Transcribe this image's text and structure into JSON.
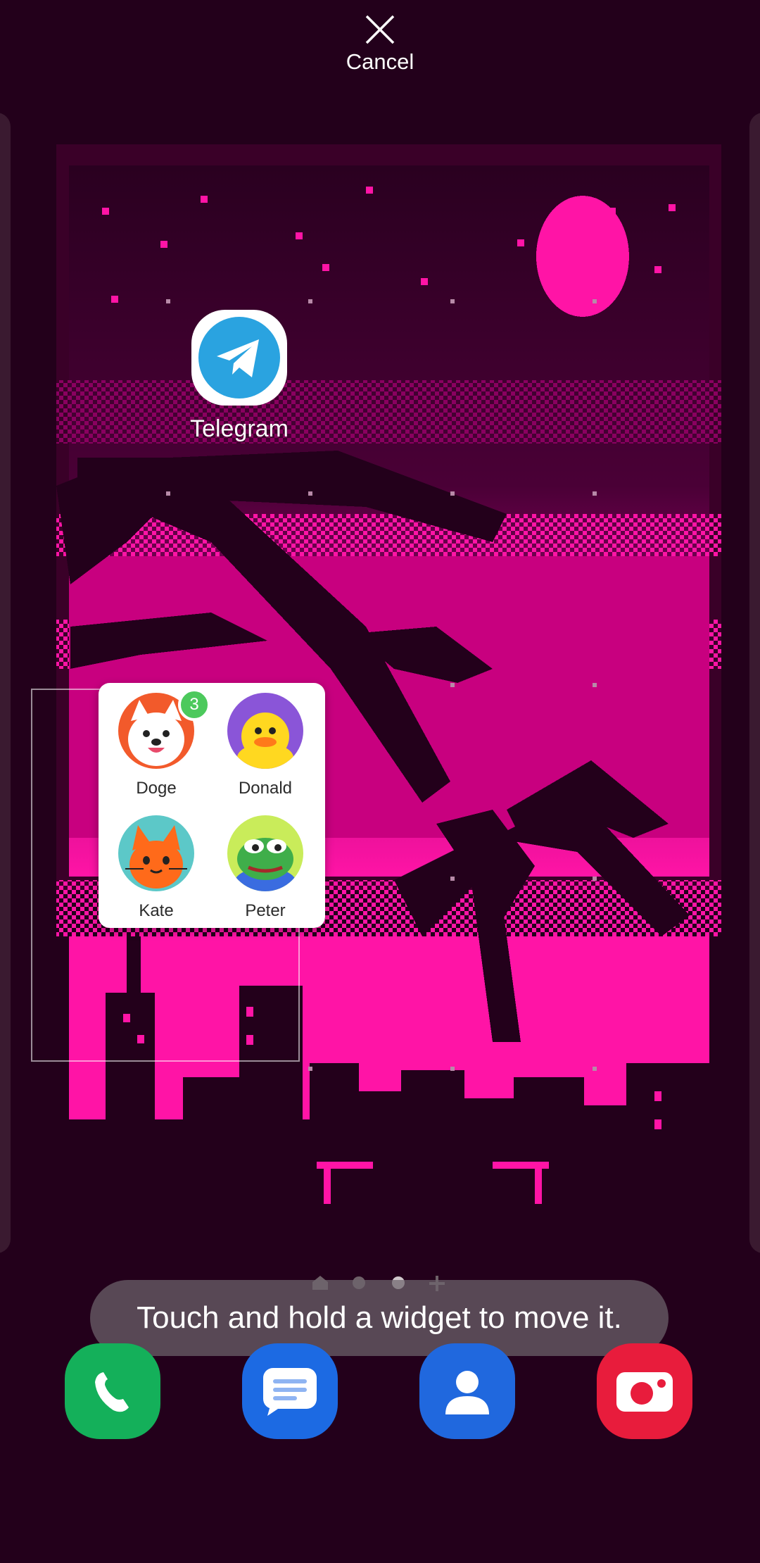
{
  "header": {
    "cancel_label": "Cancel"
  },
  "home": {
    "apps": [
      {
        "label": "Telegram",
        "icon": "telegram-icon",
        "color": "#2aa3e0"
      }
    ]
  },
  "widget": {
    "contacts": [
      {
        "name": "Doge",
        "icon": "doge-avatar",
        "badge": "3",
        "bg": "#f25a2b"
      },
      {
        "name": "Donald",
        "icon": "duck-avatar",
        "bg": "#8a55d8"
      },
      {
        "name": "Kate",
        "icon": "cat-avatar",
        "bg": "#5cc8c8"
      },
      {
        "name": "Peter",
        "icon": "frog-avatar",
        "bg": "#c9ec5a"
      }
    ]
  },
  "page_indicator": {
    "pages": 3,
    "current": 3,
    "icons": [
      "home-icon",
      "dot",
      "dot",
      "plus-icon"
    ]
  },
  "toast": {
    "text": "Touch and hold a widget to move it."
  },
  "dock": {
    "apps": [
      {
        "icon": "phone-icon",
        "color": "#14b05a"
      },
      {
        "icon": "messages-icon",
        "color": "#1c6ae3"
      },
      {
        "icon": "contacts-icon",
        "color": "#2068de"
      },
      {
        "icon": "camera-icon",
        "color": "#e81c3c"
      }
    ]
  },
  "colors": {
    "wallpaper_dark": "#23001b",
    "wallpaper_pink": "#ff14a6",
    "wallpaper_mid": "#b0007a"
  }
}
